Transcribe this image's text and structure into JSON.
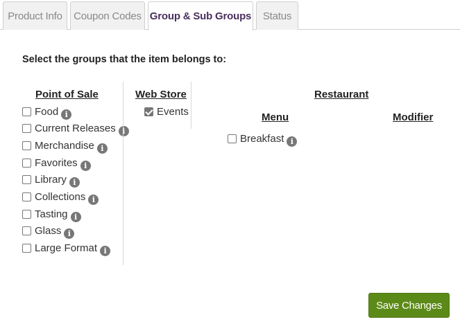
{
  "tabs": [
    {
      "label": "Product Info"
    },
    {
      "label": "Coupon Codes"
    },
    {
      "label": "Group & Sub Groups"
    },
    {
      "label": "Status"
    }
  ],
  "heading": "Select the groups that the item belongs to:",
  "pos": {
    "title": "Point of Sale",
    "items": [
      {
        "label": "Food",
        "checked": false
      },
      {
        "label": "Current Releases",
        "checked": false
      },
      {
        "label": "Merchandise",
        "checked": false
      },
      {
        "label": "Favorites",
        "checked": false
      },
      {
        "label": "Library",
        "checked": false
      },
      {
        "label": "Collections",
        "checked": false
      },
      {
        "label": "Tasting",
        "checked": false
      },
      {
        "label": "Glass",
        "checked": false
      },
      {
        "label": "Large Format",
        "checked": false
      }
    ]
  },
  "webstore": {
    "title": "Web Store",
    "items": [
      {
        "label": "Events",
        "checked": true
      }
    ]
  },
  "restaurant": {
    "title": "Restaurant",
    "menu_title": "Menu",
    "modifier_title": "Modifier",
    "menu_items": [
      {
        "label": "Breakfast",
        "checked": false
      }
    ]
  },
  "info_glyph": "i",
  "save_label": "Save Changes"
}
